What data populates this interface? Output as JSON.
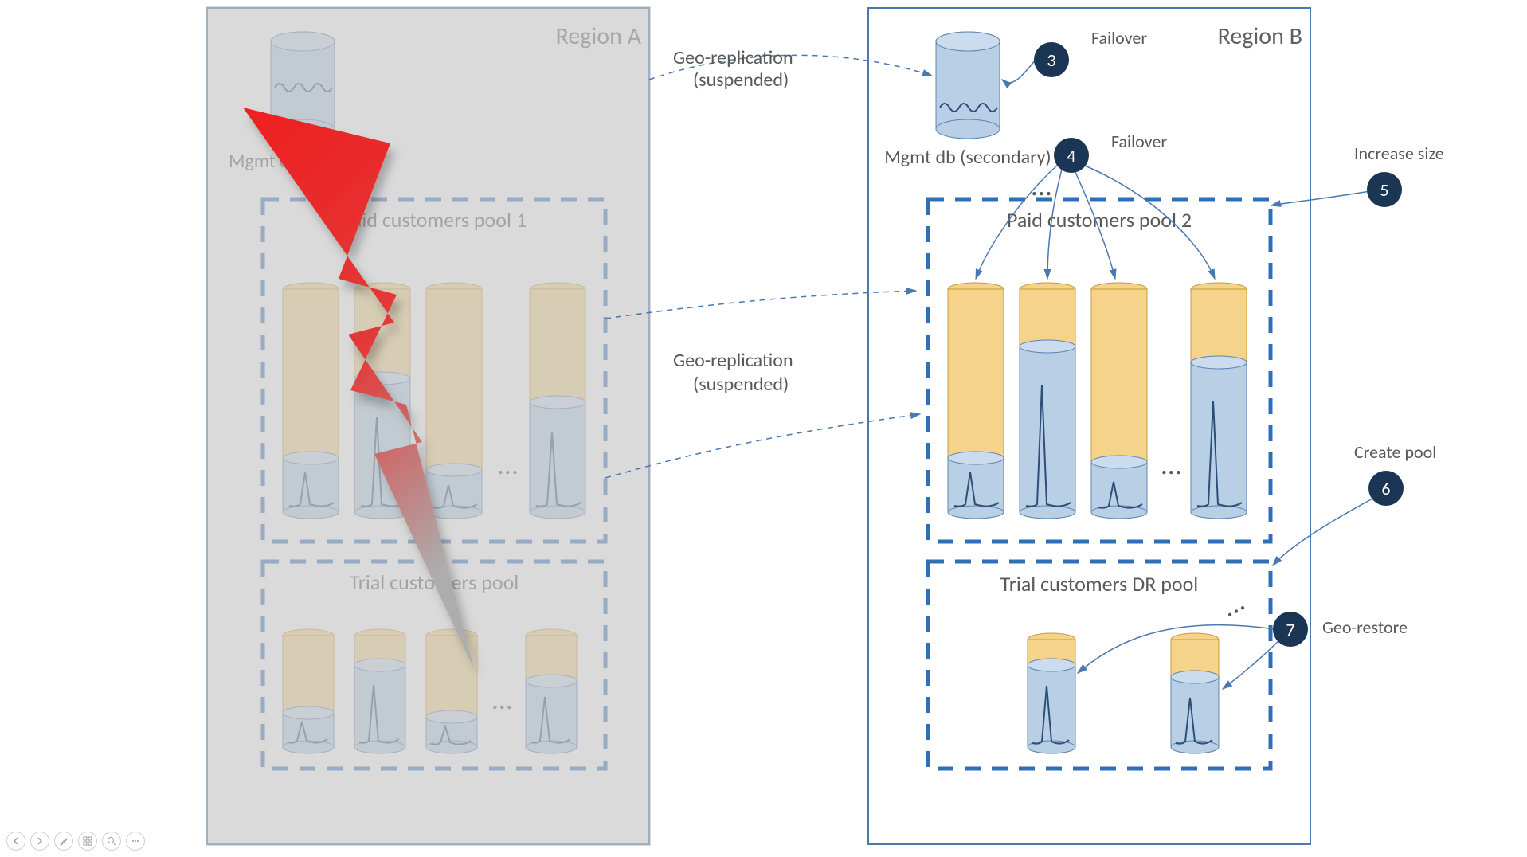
{
  "regionA": {
    "label": "Region A",
    "mgmt_db_label": "Mgmt db (primary)",
    "pool1_title": "Paid customers pool 1",
    "pool_trial_title": "Trial customers pool"
  },
  "regionB": {
    "label": "Region B",
    "mgmt_db_label": "Mgmt db (secondary)",
    "pool2_title": "Paid customers pool 2",
    "pool_dr_title": "Trial customers DR pool"
  },
  "connectors": {
    "geo_rep_top_line1": "Geo-replication",
    "geo_rep_top_line2": "(suspended)",
    "geo_rep_mid_line1": "Geo-replication",
    "geo_rep_mid_line2": "(suspended)"
  },
  "callouts": {
    "c3": {
      "num": "3",
      "label": "Failover"
    },
    "c4": {
      "num": "4",
      "label": "Failover"
    },
    "c5": {
      "num": "5",
      "label": "Increase size"
    },
    "c6": {
      "num": "6",
      "label": "Create pool"
    },
    "c7": {
      "num": "7",
      "label": "Geo-restore"
    }
  },
  "ellipsis": "…",
  "colors": {
    "region_border": "#4a78b0",
    "dash_border": "#2f6fb8",
    "cyl_yellow": "#f6d38a",
    "cyl_yellow_stroke": "#c89a3a",
    "cyl_blue": "#b8cfe6",
    "cyl_blue_stroke": "#5f84b2",
    "callout_bg": "#1b3554",
    "arrow": "#4a78b0",
    "bolt1": "#e81a1a",
    "bolt2": "#b0b0b0"
  }
}
